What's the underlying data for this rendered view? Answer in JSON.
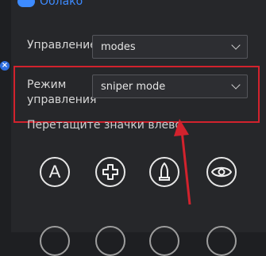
{
  "cloud": {
    "label": "Облако"
  },
  "control_mode": {
    "label": "Управление",
    "value": "modes"
  },
  "mode_setting": {
    "label": "Режим управления",
    "value": "sniper mode"
  },
  "hint": "Перетащите значки влево",
  "icons": [
    {
      "name": "letter-a-icon",
      "text": "A"
    },
    {
      "name": "dpad-icon"
    },
    {
      "name": "bullet-icon"
    },
    {
      "name": "eye-icon"
    }
  ],
  "colors": {
    "accent": "#3d8bff",
    "highlight": "#d2222d"
  }
}
